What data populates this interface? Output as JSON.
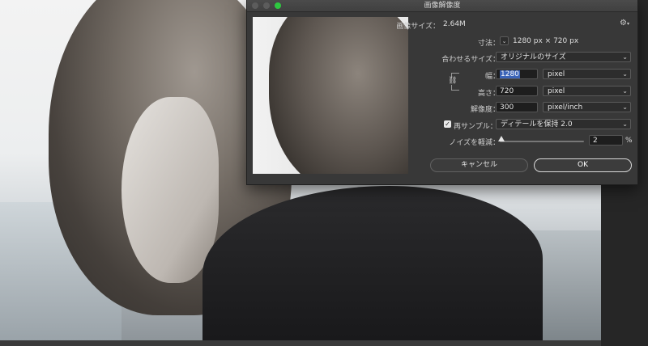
{
  "dialog": {
    "title": "画像解像度",
    "image_size_label": "画像サイズ：",
    "image_size_value": "2.64M",
    "dimensions_label": "寸法：",
    "dimensions_value": "1280 px × 720 px",
    "fit_to_label": "合わせるサイズ：",
    "fit_to_value": "オリジナルのサイズ",
    "width_label": "幅：",
    "width_value": "1280",
    "width_unit": "pixel",
    "height_label": "高さ：",
    "height_value": "720",
    "height_unit": "pixel",
    "resolution_label": "解像度：",
    "resolution_value": "300",
    "resolution_unit": "pixel/inch",
    "resample_label": "再サンプル：",
    "resample_checked": true,
    "resample_method": "ディテールを保持 2.0",
    "noise_label": "ノイズを軽減：",
    "noise_value": "2",
    "noise_unit": "%",
    "noise_slider_fraction": 0.02,
    "cancel_label": "キャンセル",
    "ok_label": "OK"
  },
  "icons": {
    "settings": "gear-icon",
    "link": "chain-link-icon",
    "dropdown": "chevron-down-icon",
    "check": "checkmark-icon"
  },
  "colors": {
    "dialog_bg": "#383838",
    "selection": "#3b64b8",
    "maximize": "#2ec840"
  }
}
